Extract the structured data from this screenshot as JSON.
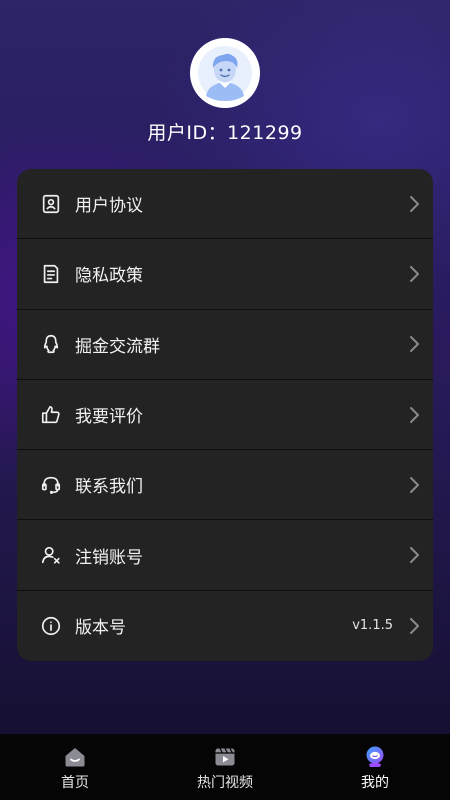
{
  "profile": {
    "avatar_icon": "user-avatar-icon",
    "user_id_text": "用户ID：121299"
  },
  "menu": {
    "items": [
      {
        "label": "用户协议",
        "icon": "user-agreement-icon"
      },
      {
        "label": "隐私政策",
        "icon": "privacy-document-icon"
      },
      {
        "label": "掘金交流群",
        "icon": "qq-penguin-icon"
      },
      {
        "label": "我要评价",
        "icon": "thumbs-up-icon"
      },
      {
        "label": "联系我们",
        "icon": "headset-icon"
      },
      {
        "label": "注销账号",
        "icon": "user-remove-icon"
      },
      {
        "label": "版本号",
        "icon": "info-icon",
        "value": "v1.1.5"
      }
    ]
  },
  "tabbar": {
    "tabs": [
      {
        "label": "首页",
        "icon": "home-icon",
        "active": false
      },
      {
        "label": "热门视频",
        "icon": "video-icon",
        "active": false
      },
      {
        "label": "我的",
        "icon": "profile-tab-icon",
        "active": true
      }
    ]
  },
  "colors": {
    "card_bg": "#232323",
    "tabbar_bg": "#050505",
    "active_tab_accent": "#8a5cf6",
    "avatar_blue": "#9bbcf5"
  }
}
